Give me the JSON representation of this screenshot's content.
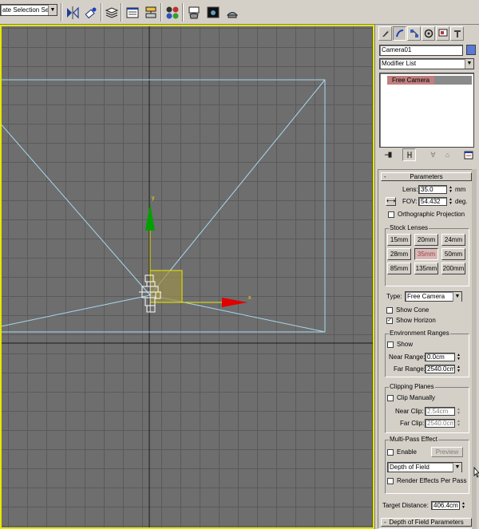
{
  "toolbar": {
    "selection_set": {
      "value": "ate Selection Set",
      "dropdown_icon": "chevron-down-icon"
    },
    "icons": [
      "mirror-icon",
      "align-icon",
      "layer-manager-icon",
      "curve-editor-icon",
      "schematic-view-icon",
      "material-editor-icon",
      "render-scene-icon",
      "render-frame-icon",
      "quick-render-icon"
    ]
  },
  "viewport": {
    "active_border_color": "#e8e800",
    "background_color": "#6e6e6e",
    "gizmo": {
      "y_axis_label": "y",
      "x_axis_label": "x",
      "y_color": "#00a000",
      "x_color": "#e00000"
    },
    "camera_wire_color": "#a8d8f0"
  },
  "command_panel": {
    "tabs": [
      "create-tab",
      "modify-tab",
      "hierarchy-tab",
      "motion-tab",
      "display-tab",
      "utilities-tab"
    ],
    "object_name": "Camera01",
    "object_color": "#5a78d8",
    "modifier_list": "Modifier List",
    "stack_items": [
      "Free Camera"
    ],
    "stack_tools": [
      "pin-stack-icon",
      "show-end-result-icon",
      "make-unique-icon",
      "remove-modifier-icon",
      "configure-modifier-sets-icon"
    ]
  },
  "parameters": {
    "rollout_title": "Parameters",
    "rollout_toggle": "-",
    "lens_label": "Lens:",
    "lens_value": "35.0",
    "lens_unit": "mm",
    "fov_label": "FOV:",
    "fov_value": "54.432",
    "fov_unit": "deg.",
    "fov_direction_icon": "⟷",
    "orthographic_label": "Orthographic Projection",
    "orthographic_checked": false,
    "stock_lenses_title": "Stock Lenses",
    "stock_lenses": [
      "15mm",
      "20mm",
      "24mm",
      "28mm",
      "35mm",
      "50mm",
      "85mm",
      "135mm",
      "200mm"
    ],
    "stock_lens_selected": "35mm",
    "type_label": "Type:",
    "type_value": "Free Camera",
    "show_cone_label": "Show Cone",
    "show_cone_checked": false,
    "show_horizon_label": "Show Horizon",
    "show_horizon_checked": true,
    "env_ranges_title": "Environment Ranges",
    "env_show_label": "Show",
    "env_show_checked": false,
    "near_range_label": "Near Range:",
    "near_range_value": "0.0cm",
    "far_range_label": "Far Range:",
    "far_range_value": "2540.0cm",
    "clipping_title": "Clipping Planes",
    "clip_manually_label": "Clip Manually",
    "clip_manually_checked": false,
    "near_clip_label": "Near Clip:",
    "near_clip_value": "2.54cm",
    "far_clip_label": "Far Clip:",
    "far_clip_value": "2540.0cm",
    "multipass_title": "Multi-Pass Effect",
    "enable_label": "Enable",
    "enable_checked": false,
    "preview_label": "Preview",
    "effect_value": "Depth of Field",
    "render_effects_label": "Render Effects Per Pass",
    "render_effects_checked": false,
    "target_distance_label": "Target Distance:",
    "target_distance_value": "406.4cm",
    "dof_rollout_title": "Depth of Field Parameters",
    "dof_rollout_toggle": "-"
  }
}
